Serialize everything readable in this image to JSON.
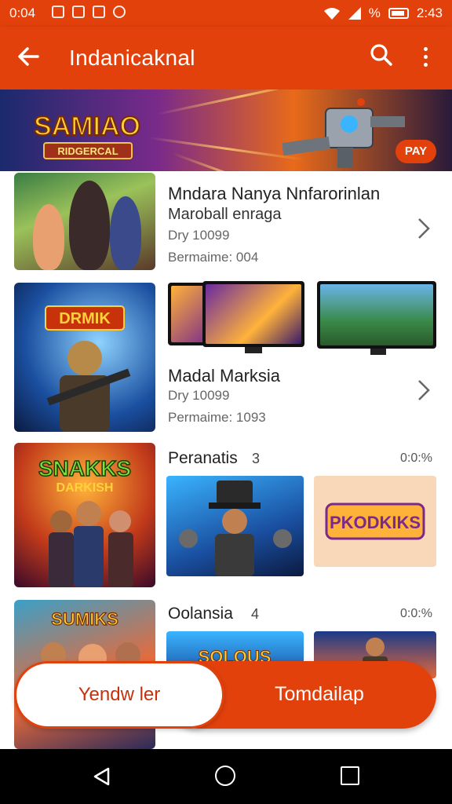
{
  "status_bar": {
    "time": "0:04",
    "right_text": "% ",
    "right_time": "2:43"
  },
  "app_bar": {
    "title": "Indanicaknal"
  },
  "banner": {
    "logo_title": "SAMIAO",
    "logo_subtitle": "RIDGERCAL",
    "play_label": "PAY"
  },
  "items": [
    {
      "title": "Mndara Nanya Nnfarorinlan",
      "subtitle": "Maroball enraga",
      "meta1": "Dry 10099",
      "meta2": "Bermaime: 004"
    },
    {
      "title": "Madal Marksia",
      "subtitle": "",
      "meta1": "Dry 10099",
      "meta2": "Permaime: 1093"
    }
  ],
  "thumb_labels": {
    "t2": "DRMIK",
    "t3_top": "SNAKKS",
    "t3_bottom": "DARKISH",
    "t4": "SUMIKS"
  },
  "sections": [
    {
      "title": "Peranatis",
      "count": "3",
      "time": "0:0:%"
    },
    {
      "title": "Oolansia",
      "count": "4",
      "time": "0:0:%"
    }
  ],
  "section_cards": {
    "s1_right": "PKODKIKS",
    "s2_left": "SOLOUS"
  },
  "buttons": {
    "left": "Yendw ler",
    "right": "Tomdailap"
  },
  "colors": {
    "primary": "#e2410c",
    "background": "#ffffff"
  },
  "icons": [
    "back-arrow-icon",
    "search-icon",
    "more-vert-icon",
    "chevron-right-icon",
    "nav-back-icon",
    "nav-home-icon",
    "nav-recent-icon"
  ]
}
